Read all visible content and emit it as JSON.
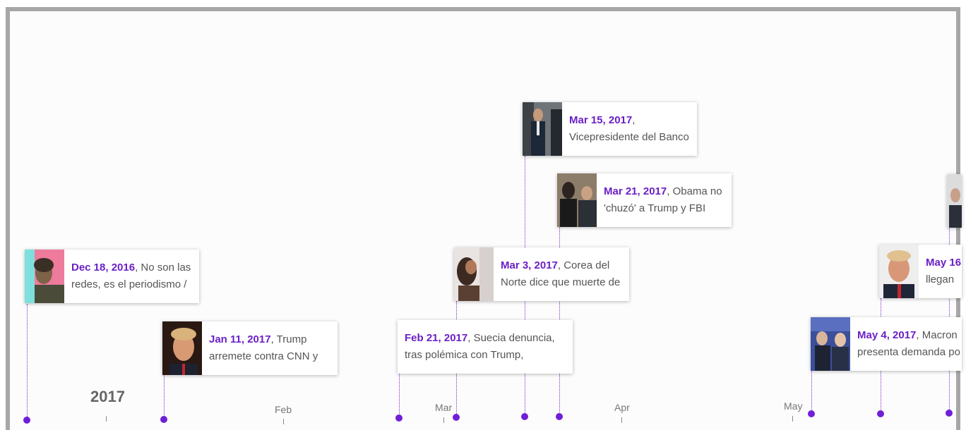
{
  "accent_color": "#6a1fc6",
  "axis": {
    "year": "2017",
    "months": [
      "Feb",
      "Mar",
      "Apr",
      "May"
    ]
  },
  "events": [
    {
      "date": "Dec 18, 2016",
      "text": ", No son las",
      "text2": "redes, es el periodismo /",
      "thumb": "woman-portrait-icon"
    },
    {
      "date": "Jan 11, 2017",
      "text": ", Trump",
      "text2": "arremete contra CNN y",
      "thumb": "trump-portrait-icon"
    },
    {
      "date": "Feb 21, 2017",
      "text": ", Suecia denuncia,",
      "text2": "tras polémica con Trump,",
      "thumb": ""
    },
    {
      "date": "Mar 3, 2017",
      "text": ", Corea del",
      "text2": "Norte dice que muerte de",
      "thumb": "person-portrait-icon"
    },
    {
      "date": "Mar 15, 2017",
      "text": ",",
      "text2": "Vicepresidente del Banco",
      "thumb": "man-in-suit-icon"
    },
    {
      "date": "Mar 21, 2017",
      "text": ", Obama no",
      "text2": "'chuzó' a Trump y FBI",
      "thumb": "group-photo-icon"
    },
    {
      "date": "May 4, 2017",
      "text": ", Macron",
      "text2": "presenta demanda po",
      "thumb": "two-people-icon"
    },
    {
      "date": "May 16",
      "text": "",
      "text2": "llegan",
      "thumb": "trump-portrait-icon"
    }
  ]
}
